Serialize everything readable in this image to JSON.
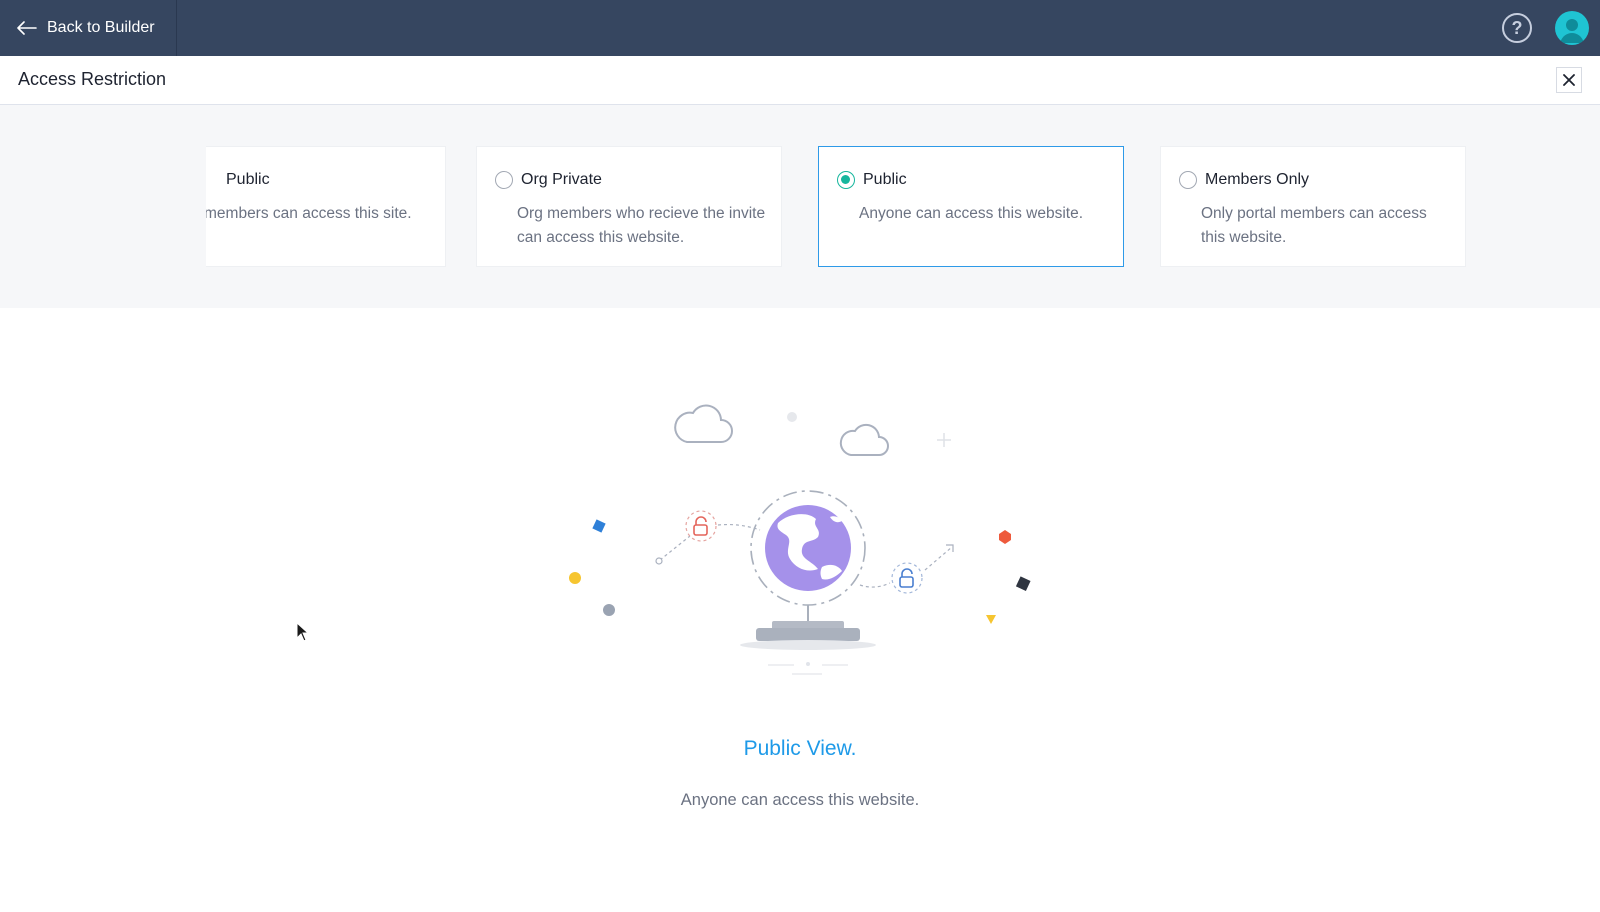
{
  "topbar": {
    "back_label": "Back to Builder",
    "help_label": "?"
  },
  "header": {
    "title": "Access Restriction"
  },
  "options": [
    {
      "title": "Public",
      "description": "members can access this site.",
      "selected": false
    },
    {
      "title": "Org Private",
      "description": "Org members who recieve the invite can access this website.",
      "selected": false
    },
    {
      "title": "Public",
      "description": "Anyone can access this website.",
      "selected": true
    },
    {
      "title": "Members Only",
      "description": "Only portal members can access this website.",
      "selected": false
    }
  ],
  "view": {
    "title": "Public View.",
    "description": "Anyone can access this website."
  },
  "colors": {
    "topbar": "#364660",
    "accent": "#1e9ae8",
    "radio_selected": "#16b69d",
    "globe": "#a591ea"
  },
  "icons": {
    "back": "arrow-left-icon",
    "help": "question-circle-icon",
    "avatar": "user-avatar-icon",
    "close": "close-icon"
  }
}
